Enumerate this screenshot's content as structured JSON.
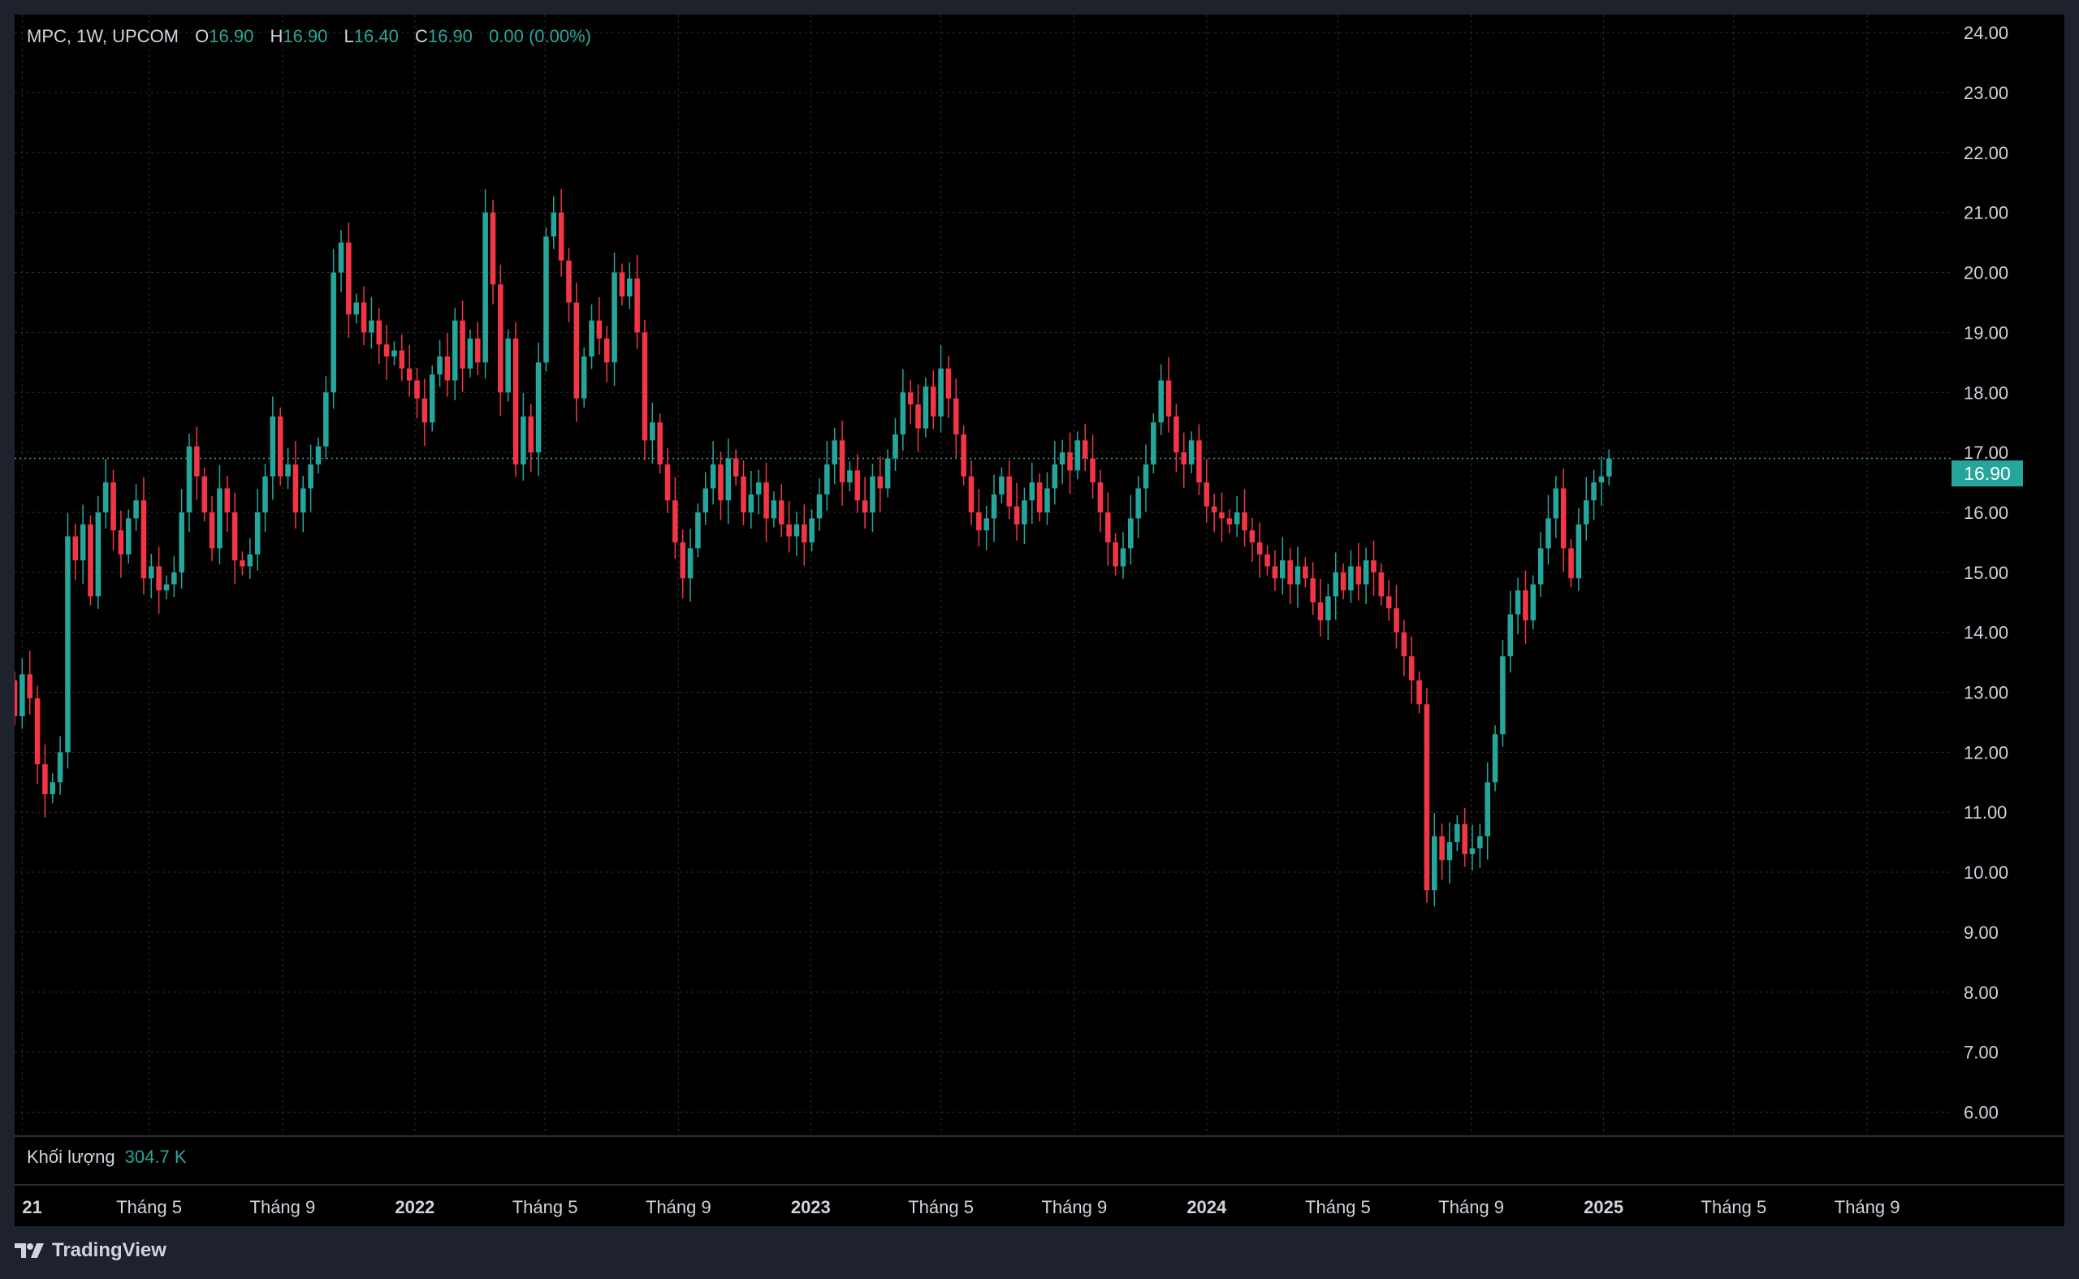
{
  "legend": {
    "symbol": "MPC, 1W, UPCOM",
    "o_label": "O",
    "o_value": "16.90",
    "h_label": "H",
    "h_value": "16.90",
    "l_label": "L",
    "l_value": "16.40",
    "c_label": "C",
    "c_value": "16.90",
    "change": "0.00 (0.00%)"
  },
  "volume": {
    "label": "Khối lượng",
    "value": "304.7 K"
  },
  "last_price_badge": "16.90",
  "brand": {
    "name": "TradingView",
    "icon": "tradingview-logo-icon"
  },
  "colors": {
    "up": "#26a69a",
    "down": "#f23645",
    "background": "#000000",
    "frame": "#1e222d",
    "grid": "#2a2e39",
    "text": "#d1d4dc"
  },
  "chart_data": {
    "type": "candlestick",
    "interval": "1W",
    "ylim": [
      5.6,
      24.3
    ],
    "y_ticks": [
      "6.00",
      "7.00",
      "8.00",
      "9.00",
      "10.00",
      "11.00",
      "12.00",
      "13.00",
      "14.00",
      "15.00",
      "16.00",
      "17.00",
      "18.00",
      "19.00",
      "20.00",
      "21.00",
      "22.00",
      "23.00",
      "24.00"
    ],
    "x_range": [
      "2020-12-28",
      "2025-11-17"
    ],
    "x_ticks": [
      {
        "label": "21",
        "date": "2021-01-04",
        "bold": true
      },
      {
        "label": "Tháng 5",
        "date": "2021-05-01",
        "bold": false
      },
      {
        "label": "Tháng 9",
        "date": "2021-09-01",
        "bold": false
      },
      {
        "label": "2022",
        "date": "2022-01-01",
        "bold": true
      },
      {
        "label": "Tháng 5",
        "date": "2022-05-01",
        "bold": false
      },
      {
        "label": "Tháng 9",
        "date": "2022-09-01",
        "bold": false
      },
      {
        "label": "2023",
        "date": "2023-01-01",
        "bold": true
      },
      {
        "label": "Tháng 5",
        "date": "2023-05-01",
        "bold": false
      },
      {
        "label": "Tháng 9",
        "date": "2023-09-01",
        "bold": false
      },
      {
        "label": "2024",
        "date": "2024-01-01",
        "bold": true
      },
      {
        "label": "Tháng 5",
        "date": "2024-05-01",
        "bold": false
      },
      {
        "label": "Tháng 9",
        "date": "2024-09-01",
        "bold": false
      },
      {
        "label": "2025",
        "date": "2025-01-01",
        "bold": true
      },
      {
        "label": "Tháng 5",
        "date": "2025-05-01",
        "bold": false
      },
      {
        "label": "Tháng 9",
        "date": "2025-09-01",
        "bold": false
      }
    ],
    "last_price": 16.9,
    "grid": true,
    "candles": {
      "start_date": "2020-12-28",
      "interval_days": 7,
      "first_open": 13.2,
      "closes": [
        12.6,
        13.3,
        12.9,
        11.8,
        11.3,
        11.5,
        12.0,
        15.6,
        15.2,
        15.8,
        14.6,
        16.0,
        16.5,
        15.7,
        15.3,
        15.9,
        16.2,
        14.9,
        15.1,
        14.7,
        14.8,
        15.0,
        16.0,
        17.1,
        16.6,
        16.0,
        15.4,
        16.4,
        16.0,
        15.2,
        15.1,
        15.3,
        16.0,
        16.6,
        17.6,
        16.6,
        16.8,
        16.0,
        16.4,
        16.8,
        17.1,
        18.0,
        20.0,
        20.5,
        19.3,
        19.5,
        19.0,
        19.2,
        18.8,
        18.6,
        18.7,
        18.4,
        18.2,
        17.9,
        17.5,
        18.3,
        18.6,
        18.2,
        19.2,
        18.4,
        18.9,
        18.5,
        21.0,
        19.8,
        18.0,
        18.9,
        16.8,
        17.6,
        17.0,
        18.5,
        20.6,
        21.0,
        20.2,
        19.5,
        17.9,
        18.6,
        19.2,
        18.9,
        18.5,
        20.0,
        19.6,
        19.9,
        19.0,
        17.2,
        17.5,
        16.8,
        16.2,
        15.5,
        14.9,
        15.4,
        16.0,
        16.4,
        16.8,
        16.2,
        16.9,
        16.6,
        16.0,
        16.3,
        16.5,
        15.9,
        16.2,
        15.8,
        15.6,
        15.8,
        15.5,
        15.9,
        16.3,
        16.8,
        17.2,
        16.5,
        16.7,
        16.2,
        16.0,
        16.6,
        16.4,
        16.9,
        17.3,
        18.0,
        17.8,
        17.4,
        18.1,
        17.6,
        18.4,
        17.9,
        17.3,
        16.6,
        16.0,
        15.7,
        15.9,
        16.3,
        16.6,
        16.1,
        15.8,
        16.2,
        16.5,
        16.0,
        16.4,
        16.8,
        17.0,
        16.7,
        17.2,
        16.9,
        16.5,
        16.0,
        15.5,
        15.1,
        15.4,
        15.9,
        16.4,
        16.8,
        17.5,
        18.2,
        17.6,
        17.0,
        16.8,
        17.2,
        16.5,
        16.1,
        16.0,
        15.9,
        15.8,
        16.0,
        15.7,
        15.5,
        15.3,
        15.1,
        14.9,
        15.2,
        14.8,
        15.1,
        14.9,
        14.5,
        14.2,
        14.6,
        15.0,
        14.7,
        15.1,
        14.8,
        15.2,
        15.0,
        14.6,
        14.4,
        14.0,
        13.6,
        13.2,
        12.8,
        9.7,
        10.6,
        10.2,
        10.5,
        10.8,
        10.3,
        10.4,
        10.6,
        11.5,
        12.3,
        13.6,
        14.3,
        14.7,
        14.2,
        14.8,
        15.4,
        15.9,
        16.4,
        15.4,
        14.9,
        15.8,
        16.2,
        16.5,
        16.6,
        16.9
      ]
    }
  }
}
